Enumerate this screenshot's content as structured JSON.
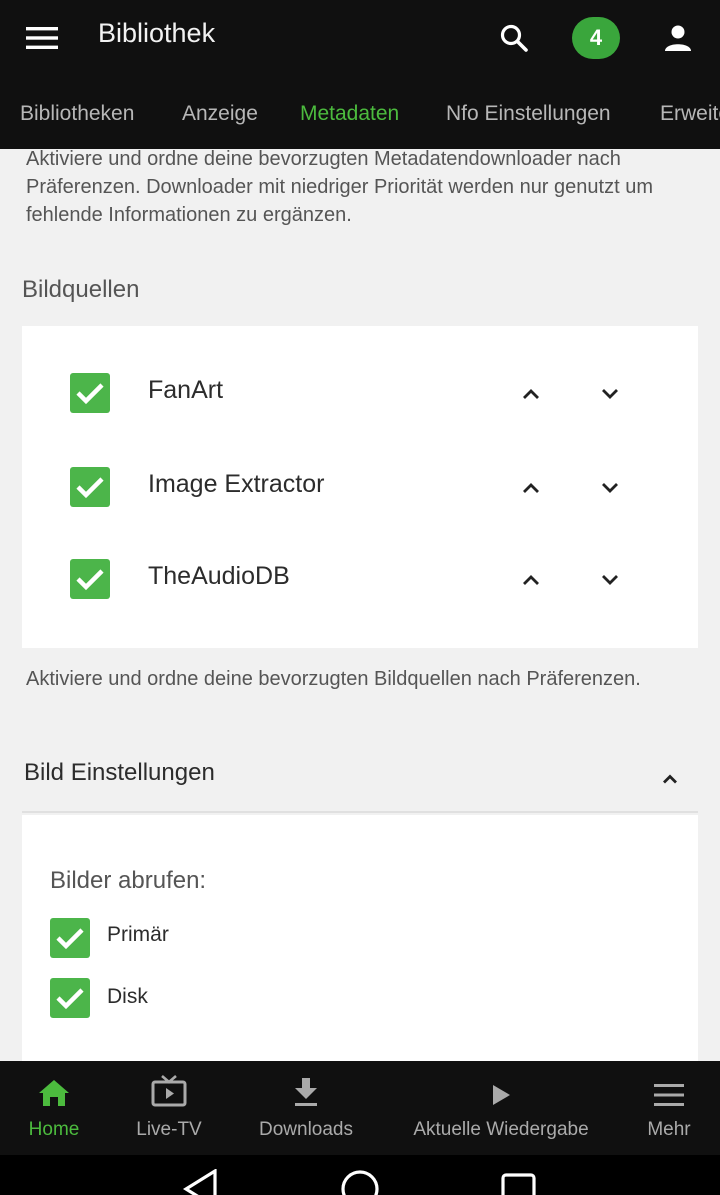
{
  "appbar": {
    "title": "Bibliothek",
    "menu_icon": "hamburger-menu-icon",
    "search_icon": "search-icon",
    "badge_count": "4",
    "user_icon": "user-icon"
  },
  "tabs": [
    {
      "label": "Bibliotheken",
      "active": false
    },
    {
      "label": "Anzeige",
      "active": false
    },
    {
      "label": "Metadaten",
      "active": true
    },
    {
      "label": "Nfo Einstellungen",
      "active": false
    },
    {
      "label": "Erweitert",
      "active": false
    }
  ],
  "metadata_description": "Aktiviere und ordne deine bevorzugten Metadatendownloader nach Präferenzen. Downloader mit niedriger Priorität werden nur genutzt um fehlende Informationen zu ergänzen.",
  "image_sources": {
    "title": "Bildquellen",
    "items": [
      {
        "label": "FanArt",
        "checked": true
      },
      {
        "label": "Image Extractor",
        "checked": true
      },
      {
        "label": "TheAudioDB",
        "checked": true
      }
    ],
    "description": "Aktiviere und ordne deine bevorzugten Bildquellen nach Präferenzen."
  },
  "image_settings": {
    "title": "Bild Einstellungen",
    "fetch_label": "Bilder abrufen:",
    "options": [
      {
        "label": "Primär",
        "checked": true
      },
      {
        "label": "Disk",
        "checked": true
      }
    ]
  },
  "bottom_nav": [
    {
      "label": "Home",
      "icon": "home-icon",
      "active": true
    },
    {
      "label": "Live-TV",
      "icon": "tv-icon",
      "active": false
    },
    {
      "label": "Downloads",
      "icon": "download-icon",
      "active": false
    },
    {
      "label": "Aktuelle Wiedergabe",
      "icon": "play-icon",
      "active": false
    },
    {
      "label": "Mehr",
      "icon": "menu-icon",
      "active": false
    }
  ],
  "colors": {
    "accent": "#4cbb3e",
    "checkbox": "#4cb54a",
    "bar_background": "#101010",
    "content_background": "#f1f1f1"
  }
}
